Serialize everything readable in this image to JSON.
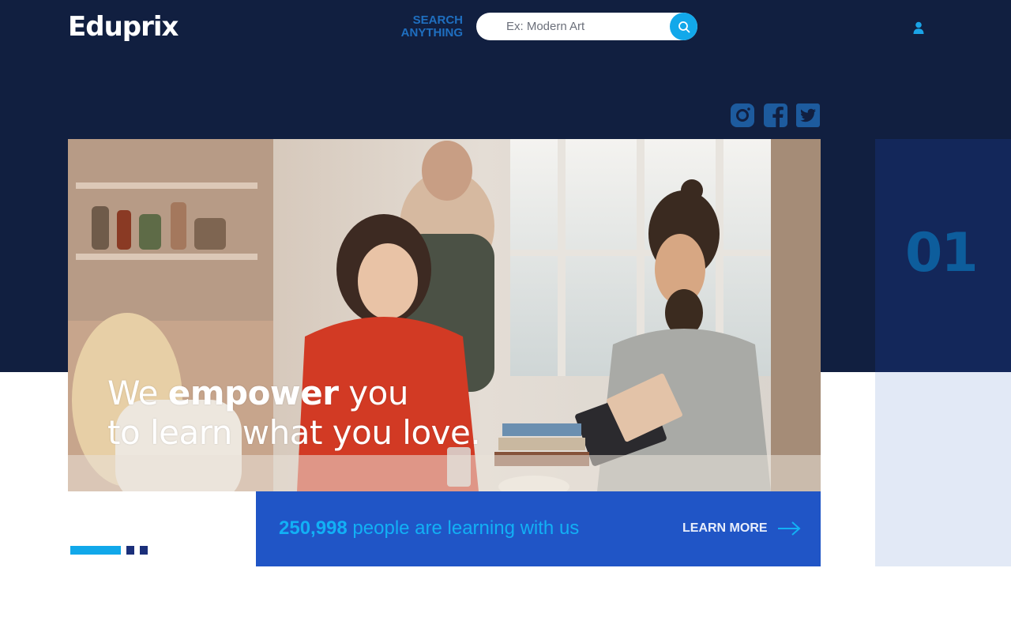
{
  "brand": {
    "name": "Eduprix"
  },
  "search": {
    "label": "SEARCH ANYTHING",
    "placeholder": "Ex: Modern Art"
  },
  "icons": {
    "search": "search-icon",
    "user": "user-icon",
    "instagram": "instagram-icon",
    "facebook": "facebook-icon",
    "twitter": "twitter-icon",
    "arrow": "arrow-right-icon"
  },
  "hero": {
    "line1_prefix": "We ",
    "line1_emphasis": "empower",
    "line1_suffix": " you",
    "line2": "to learn what you love."
  },
  "stats": {
    "count": "250,998",
    "text": " people are learning with us"
  },
  "cta": {
    "label": "LEARN MORE"
  },
  "slider": {
    "current": "01",
    "total_indicators": 3,
    "active_index": 0
  },
  "colors": {
    "navy": "#111f40",
    "accent": "#12a8ea",
    "stats_bg": "#2055c6",
    "side_dark": "#13275a",
    "side_light": "#e2e9f6"
  }
}
